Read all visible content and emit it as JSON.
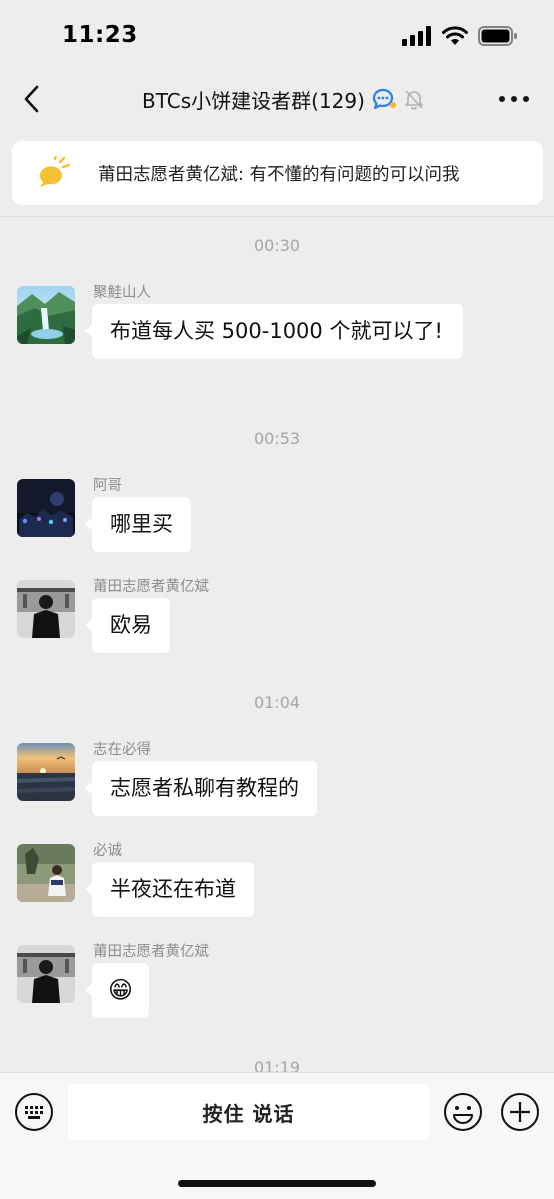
{
  "status_bar": {
    "time": "11:23"
  },
  "nav": {
    "title": "BTCs小饼建设者群(129)",
    "back_icon": "chevron-left-icon",
    "more_icon": "more-dots-icon"
  },
  "notice": {
    "text": "莆田志愿者黄亿斌: 有不懂的有问题的可以问我"
  },
  "messages": [
    {
      "time": "00:30"
    },
    {
      "sender": "聚鮭山人",
      "text": "布道每人买 500-1000 个就可以了!"
    },
    {
      "time": "00:53"
    },
    {
      "sender": "阿哥",
      "text": "哪里买"
    },
    {
      "sender": "莆田志愿者黄亿斌",
      "text": "欧易"
    },
    {
      "time": "01:04"
    },
    {
      "sender": "志在必得",
      "text": "志愿者私聊有教程的"
    },
    {
      "sender": "必诚",
      "text": "半夜还在布道"
    },
    {
      "sender": "莆田志愿者黄亿斌",
      "text": "😁"
    },
    {
      "time": "01:19"
    }
  ],
  "input_bar": {
    "hold_to_talk": "按住 说话"
  },
  "colors": {
    "background": "#ededed",
    "bubble": "#ffffff",
    "accent_blue": "#2a7ff0",
    "notice_icon": "#f5c033"
  }
}
